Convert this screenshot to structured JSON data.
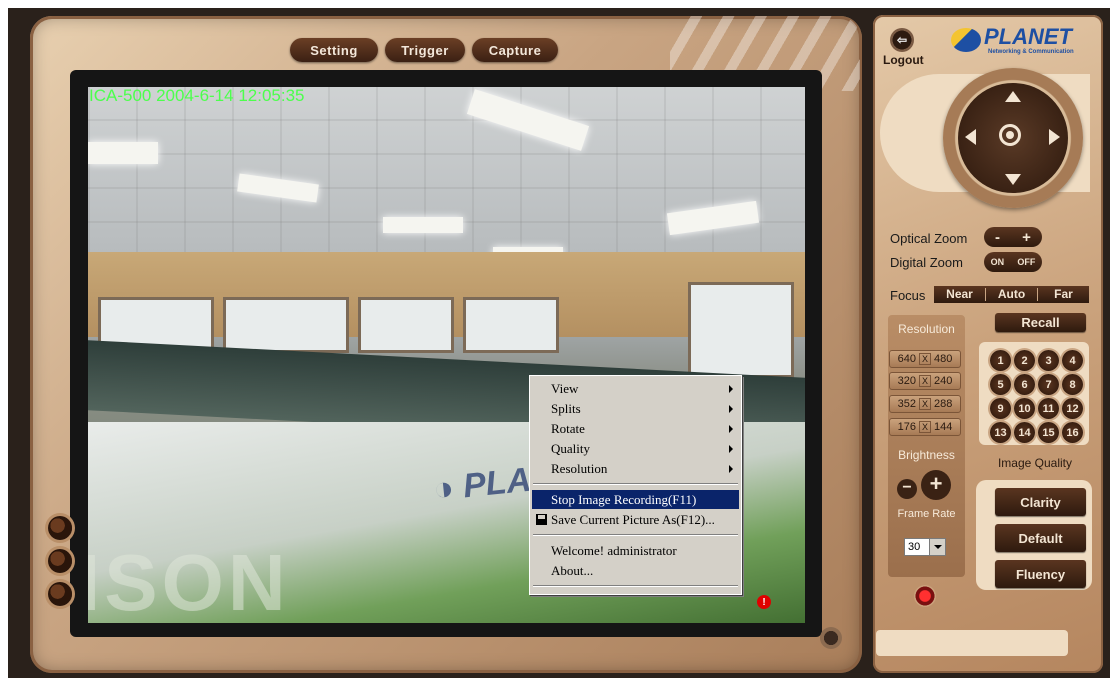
{
  "toolbar": {
    "setting_label": "Setting",
    "trigger_label": "Trigger",
    "capture_label": "Capture"
  },
  "video": {
    "overlay_text": "ICA-500  2004-6-14 12:05:35",
    "record_indicator": "!"
  },
  "context_menu": {
    "items": [
      {
        "label": "View",
        "submenu": true
      },
      {
        "label": "Splits",
        "submenu": true
      },
      {
        "label": "Rotate",
        "submenu": true
      },
      {
        "label": "Quality",
        "submenu": true
      },
      {
        "label": "Resolution",
        "submenu": true
      }
    ],
    "actions": [
      {
        "label": "Stop Image Recording(F11)",
        "highlighted": true
      },
      {
        "label": "Save Current Picture As(F12)...",
        "icon": "floppy-icon"
      }
    ],
    "info": [
      {
        "label": "Welcome! administrator"
      },
      {
        "label": "About..."
      }
    ],
    "highlight_color": "#0a246a"
  },
  "header": {
    "logout_label": "Logout",
    "brand_name": "PLANET",
    "brand_tagline": "Networking & Communication"
  },
  "zoom": {
    "optical_label": "Optical Zoom",
    "minus": "-",
    "plus": "+",
    "digital_label": "Digital  Zoom",
    "on": "ON",
    "off": "OFF"
  },
  "focus": {
    "label": "Focus",
    "near": "Near",
    "auto": "Auto",
    "far": "Far"
  },
  "recall_label": "Recall",
  "resolution": {
    "title": "Resolution",
    "options": [
      {
        "w": "640",
        "h": "480"
      },
      {
        "w": "320",
        "h": "240"
      },
      {
        "w": "352",
        "h": "288"
      },
      {
        "w": "176",
        "h": "144"
      }
    ],
    "x": "X"
  },
  "presets": [
    "1",
    "2",
    "3",
    "4",
    "5",
    "6",
    "7",
    "8",
    "9",
    "10",
    "11",
    "12",
    "13",
    "14",
    "15",
    "16"
  ],
  "brightness": {
    "title": "Brightness",
    "minus": "−",
    "plus": "+"
  },
  "frame_rate": {
    "title": "Frame Rate",
    "value": "30"
  },
  "image_quality": {
    "title": "Image Quality",
    "clarity": "Clarity",
    "default": "Default",
    "fluency": "Fluency"
  },
  "colors": {
    "bezel": "#c9a583",
    "button_dark": "#2e1a0e",
    "overlay_green": "#4cff4c",
    "brand_blue": "#1d4fa3"
  }
}
